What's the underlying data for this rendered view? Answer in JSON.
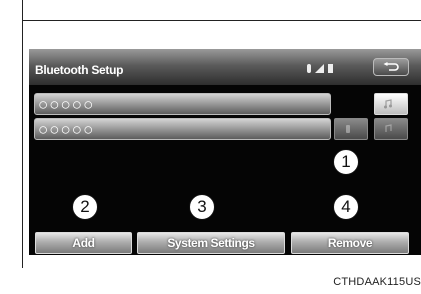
{
  "screen": {
    "title": "Bluetooth Setup",
    "devices": [
      {
        "name": "○○○○○"
      },
      {
        "name": "○○○○○"
      }
    ],
    "buttons": {
      "add": "Add",
      "system_settings": "System Settings",
      "remove": "Remove"
    }
  },
  "callouts": [
    "1",
    "2",
    "3",
    "4"
  ],
  "caption": "CTHDAAK115US",
  "icons": [
    "bluetooth-icon",
    "signal-icon",
    "battery-icon",
    "back-icon",
    "phone-icon",
    "music-icon"
  ]
}
